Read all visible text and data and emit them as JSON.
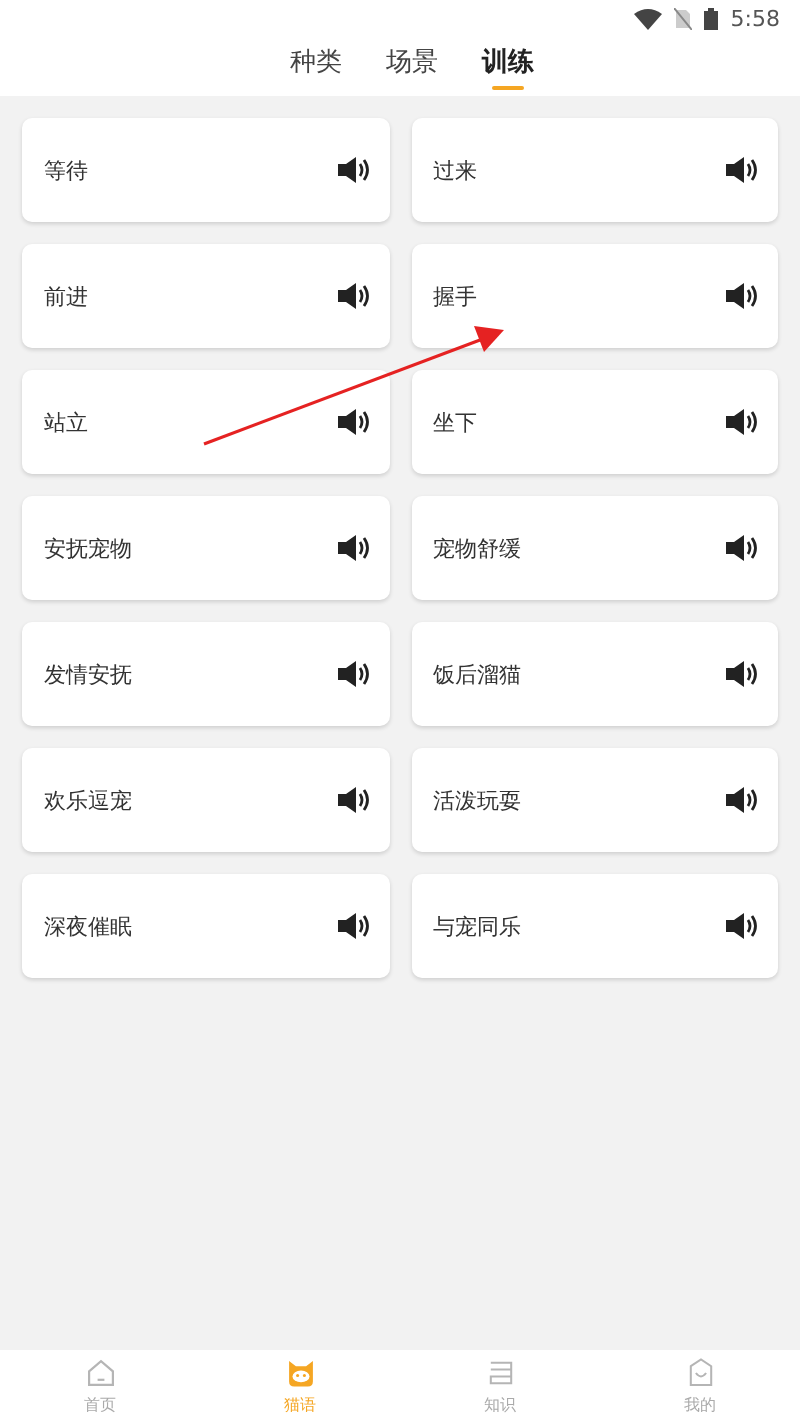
{
  "status_bar": {
    "time": "5:58"
  },
  "tabs": [
    {
      "label": "种类",
      "selected": false
    },
    {
      "label": "场景",
      "selected": false
    },
    {
      "label": "训练",
      "selected": true
    }
  ],
  "sounds": [
    {
      "label": "等待"
    },
    {
      "label": "过来"
    },
    {
      "label": "前进"
    },
    {
      "label": "握手"
    },
    {
      "label": "站立"
    },
    {
      "label": "坐下"
    },
    {
      "label": "安抚宠物"
    },
    {
      "label": "宠物舒缓"
    },
    {
      "label": "发情安抚"
    },
    {
      "label": "饭后溜猫"
    },
    {
      "label": "欢乐逗宠"
    },
    {
      "label": "活泼玩耍"
    },
    {
      "label": "深夜催眠"
    },
    {
      "label": "与宠同乐"
    }
  ],
  "bottom_nav": [
    {
      "label": "首页",
      "kind": "home",
      "selected": false
    },
    {
      "label": "猫语",
      "kind": "cat",
      "selected": true
    },
    {
      "label": "知识",
      "kind": "book",
      "selected": false
    },
    {
      "label": "我的",
      "kind": "profile",
      "selected": false
    }
  ]
}
